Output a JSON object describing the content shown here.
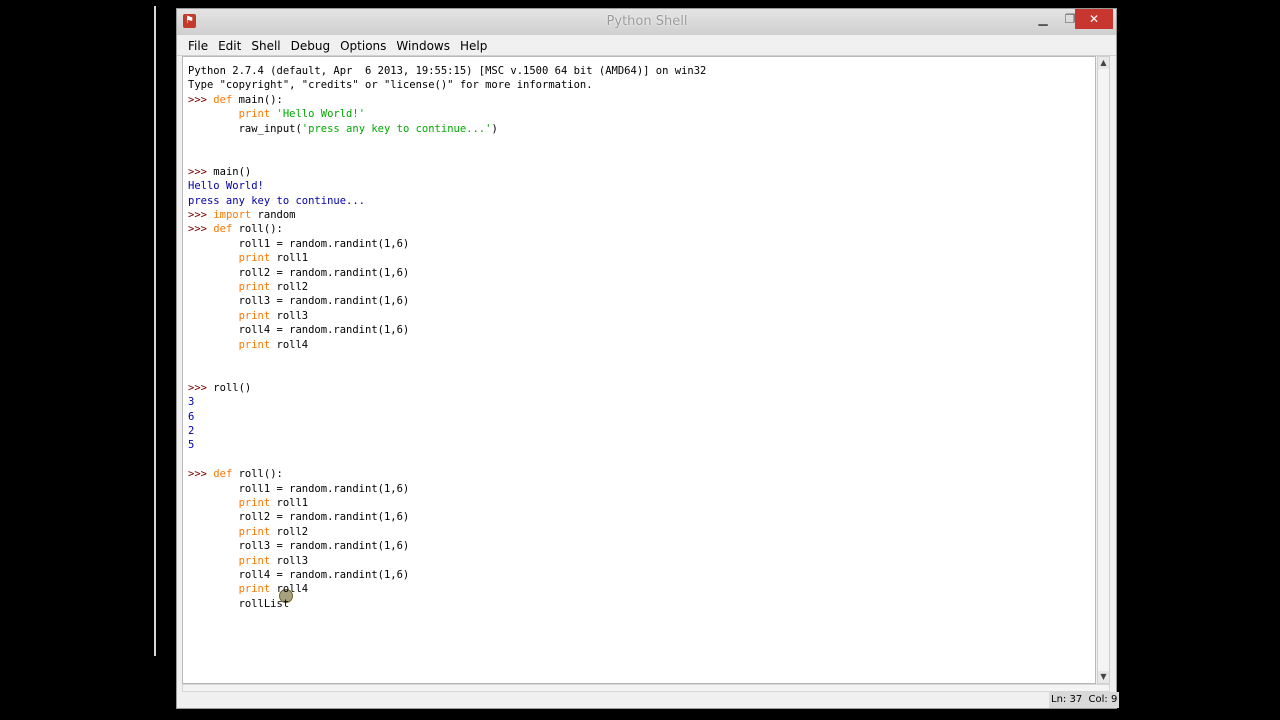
{
  "window": {
    "title": "Python Shell",
    "icon": "python-shell-icon",
    "controls": {
      "minimize": "▁",
      "maximize": "❐",
      "close": "✕"
    }
  },
  "menu": [
    "File",
    "Edit",
    "Shell",
    "Debug",
    "Options",
    "Windows",
    "Help"
  ],
  "shell": {
    "colors": {
      "prompt": "#770000",
      "keyword": "#ff7700",
      "string": "#00aa00",
      "output": "#0000aa"
    },
    "lines": [
      [
        {
          "t": "Python 2.7.4 (default, Apr  6 2013, 19:55:15) [MSC v.1500 64 bit (AMD64)] on win32",
          "c": "plain"
        }
      ],
      [
        {
          "t": "Type \"copyright\", \"credits\" or \"license()\" for more information.",
          "c": "plain"
        }
      ],
      [
        {
          "t": ">>> ",
          "c": "prompt"
        },
        {
          "t": "def",
          "c": "kw"
        },
        {
          "t": " main():",
          "c": "plain"
        }
      ],
      [
        {
          "t": "        print ",
          "c": "kw"
        },
        {
          "t": "'Hello World!'",
          "c": "str"
        }
      ],
      [
        {
          "t": "        raw_input(",
          "c": "plain"
        },
        {
          "t": "'press any key to continue...'",
          "c": "str"
        },
        {
          "t": ")",
          "c": "plain"
        }
      ],
      [],
      [],
      [
        {
          "t": ">>> ",
          "c": "prompt"
        },
        {
          "t": "main()",
          "c": "plain"
        }
      ],
      [
        {
          "t": "Hello World!",
          "c": "out"
        }
      ],
      [
        {
          "t": "press any key to continue...",
          "c": "out"
        }
      ],
      [
        {
          "t": ">>> ",
          "c": "prompt"
        },
        {
          "t": "import",
          "c": "kw"
        },
        {
          "t": " random",
          "c": "plain"
        }
      ],
      [
        {
          "t": ">>> ",
          "c": "prompt"
        },
        {
          "t": "def",
          "c": "kw"
        },
        {
          "t": " roll():",
          "c": "plain"
        }
      ],
      [
        {
          "t": "        roll1 = random.randint(1,6)",
          "c": "plain"
        }
      ],
      [
        {
          "t": "        print",
          "c": "kw"
        },
        {
          "t": " roll1",
          "c": "plain"
        }
      ],
      [
        {
          "t": "        roll2 = random.randint(1,6)",
          "c": "plain"
        }
      ],
      [
        {
          "t": "        print",
          "c": "kw"
        },
        {
          "t": " roll2",
          "c": "plain"
        }
      ],
      [
        {
          "t": "        roll3 = random.randint(1,6)",
          "c": "plain"
        }
      ],
      [
        {
          "t": "        print",
          "c": "kw"
        },
        {
          "t": " roll3",
          "c": "plain"
        }
      ],
      [
        {
          "t": "        roll4 = random.randint(1,6)",
          "c": "plain"
        }
      ],
      [
        {
          "t": "        print",
          "c": "kw"
        },
        {
          "t": " roll4",
          "c": "plain"
        }
      ],
      [],
      [],
      [
        {
          "t": ">>> ",
          "c": "prompt"
        },
        {
          "t": "roll()",
          "c": "plain"
        }
      ],
      [
        {
          "t": "3",
          "c": "out"
        }
      ],
      [
        {
          "t": "6",
          "c": "out"
        }
      ],
      [
        {
          "t": "2",
          "c": "out"
        }
      ],
      [
        {
          "t": "5",
          "c": "out"
        }
      ],
      [],
      [
        {
          "t": ">>> ",
          "c": "prompt"
        },
        {
          "t": "def",
          "c": "kw"
        },
        {
          "t": " roll():",
          "c": "plain"
        }
      ],
      [
        {
          "t": "        roll1 = random.randint(1,6)",
          "c": "plain"
        }
      ],
      [
        {
          "t": "        print",
          "c": "kw"
        },
        {
          "t": " roll1",
          "c": "plain"
        }
      ],
      [
        {
          "t": "        roll2 = random.randint(1,6)",
          "c": "plain"
        }
      ],
      [
        {
          "t": "        print",
          "c": "kw"
        },
        {
          "t": " roll2",
          "c": "plain"
        }
      ],
      [
        {
          "t": "        roll3 = random.randint(1,6)",
          "c": "plain"
        }
      ],
      [
        {
          "t": "        print",
          "c": "kw"
        },
        {
          "t": " roll3",
          "c": "plain"
        }
      ],
      [
        {
          "t": "        roll4 = random.randint(1,6)",
          "c": "plain"
        }
      ],
      [
        {
          "t": "        print",
          "c": "kw"
        },
        {
          "t": " roll4",
          "c": "plain"
        }
      ],
      [
        {
          "t": "        rollList",
          "c": "plain"
        }
      ]
    ]
  },
  "status": {
    "text": "Ln: 37  Col: 9"
  }
}
